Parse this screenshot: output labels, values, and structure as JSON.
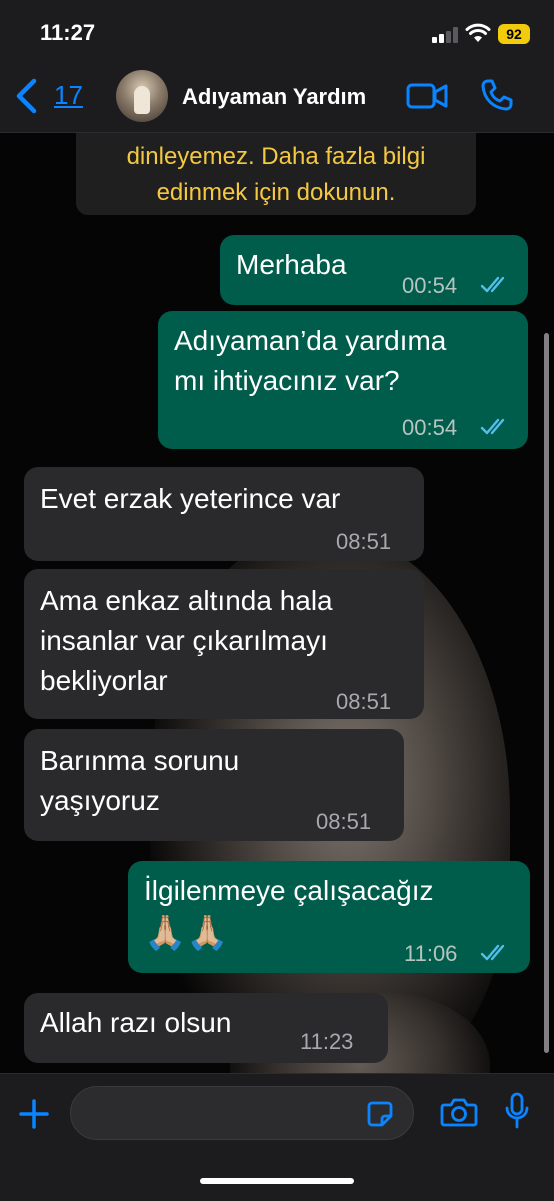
{
  "status_bar": {
    "time": "11:27",
    "battery": "92"
  },
  "header": {
    "back_count": "17",
    "contact_name": "Adıyaman Yardım"
  },
  "notice": {
    "text": "dinleyemez. Daha fazla bilgi\nedinmek için dokunun."
  },
  "messages": [
    {
      "direction": "out",
      "text": "Merhaba",
      "time": "00:54",
      "read": true
    },
    {
      "direction": "out",
      "text": "Adıyaman’da yardıma\nmı ihtiyacınız var?",
      "time": "00:54",
      "read": true
    },
    {
      "direction": "in",
      "text": "Evet erzak yeterince var",
      "time": "08:51"
    },
    {
      "direction": "in",
      "text": "Ama enkaz altında hala\ninsanlar var çıkarılmayı\nbekliyorlar",
      "time": "08:51"
    },
    {
      "direction": "in",
      "text": "Barınma sorunu\nyaşıyoruz",
      "time": "08:51"
    },
    {
      "direction": "out",
      "text": "İlgilenmeye çalışacağız",
      "emoji": "🙏🏼🙏🏼",
      "time": "11:06",
      "read": true
    },
    {
      "direction": "in",
      "text": "Allah razı olsun",
      "time": "11:23"
    }
  ],
  "composer": {
    "value": "",
    "placeholder": ""
  },
  "colors": {
    "outgoing_bubble": "#005c4b",
    "incoming_bubble": "#2a2a2c",
    "accent_blue": "#0a84ff",
    "read_tick": "#53bdeb",
    "notice_text": "#f5c842",
    "battery": "#f2cc0c"
  },
  "icons": {
    "back": "chevron-left-icon",
    "video": "video-camera-icon",
    "call": "phone-icon",
    "attach": "plus-icon",
    "sticker": "sticker-icon",
    "camera": "camera-icon",
    "voice": "microphone-icon"
  }
}
